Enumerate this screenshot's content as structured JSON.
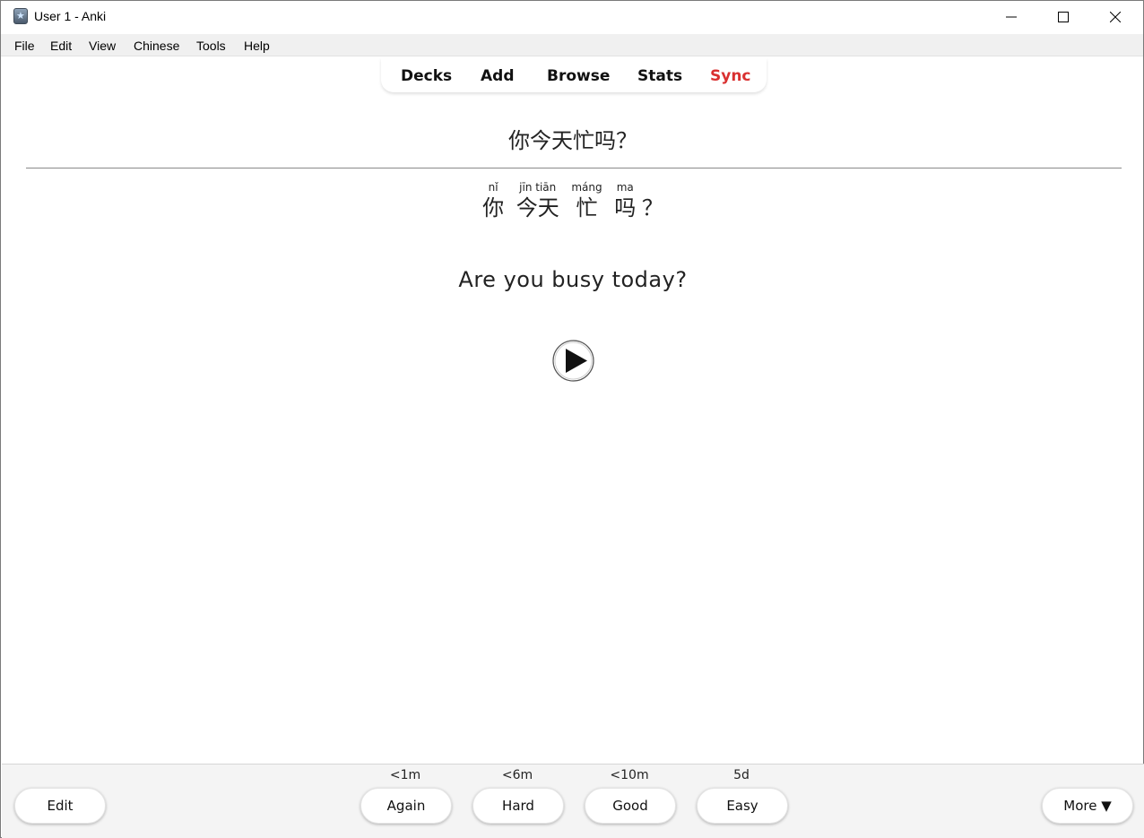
{
  "window": {
    "title": "User 1 - Anki"
  },
  "menu": [
    "File",
    "Edit",
    "View",
    "Chinese",
    "Tools",
    "Help"
  ],
  "toolbar": {
    "decks": "Decks",
    "add": "Add",
    "browse": "Browse",
    "stats": "Stats",
    "sync": "Sync",
    "sync_color": "#d93030"
  },
  "card": {
    "front": "你今天忙吗？",
    "ruby": [
      {
        "pinyin": "nǐ",
        "hanzi": "你"
      },
      {
        "pinyin": "jīn tiān",
        "hanzi": "今天"
      },
      {
        "pinyin": "máng",
        "hanzi": "忙"
      },
      {
        "pinyin": "ma",
        "hanzi": "吗"
      },
      {
        "pinyin": "",
        "hanzi": "？"
      }
    ],
    "english": "Are you busy today?",
    "audio_icon": "play-icon"
  },
  "bottom": {
    "edit": "Edit",
    "more": "More ▼",
    "answers": [
      {
        "label": "Again",
        "time": "<1m"
      },
      {
        "label": "Hard",
        "time": "<6m"
      },
      {
        "label": "Good",
        "time": "<10m"
      },
      {
        "label": "Easy",
        "time": "5d"
      }
    ]
  }
}
